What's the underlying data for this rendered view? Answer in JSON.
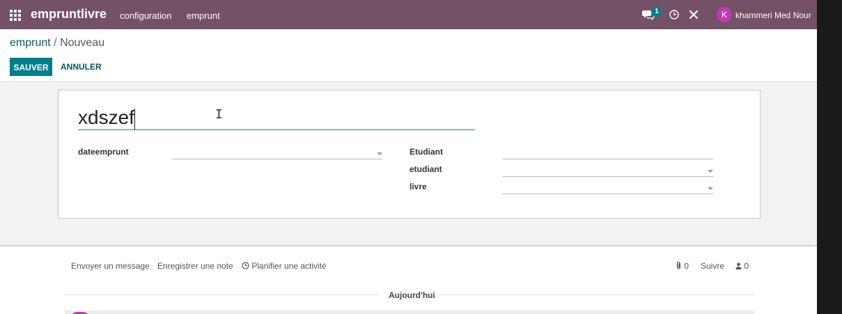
{
  "navbar": {
    "app_name": "empruntlivre",
    "menu_items": [
      "configuration",
      "emprunt"
    ],
    "messages_badge": "1",
    "user_initial": "K",
    "user_name": "khammeri Med Nour"
  },
  "breadcrumb": {
    "parent": "emprunt",
    "separator": "/",
    "current": "Nouveau"
  },
  "buttons": {
    "save": "SAUVER",
    "cancel": "ANNULER"
  },
  "form": {
    "name_value": "xdszef",
    "fields": {
      "dateemprunt": {
        "label": "dateemprunt",
        "value": ""
      },
      "Etudiant": {
        "label": "Etudiant",
        "value": ""
      },
      "etudiant": {
        "label": "etudiant",
        "value": ""
      },
      "livre": {
        "label": "livre",
        "value": ""
      }
    }
  },
  "chatter": {
    "send_message": "Envoyer un message",
    "log_note": "Enregistrer une note",
    "schedule_activity": "Planifier une activité",
    "attachments_count": "0",
    "follow": "Suivre",
    "followers_count": "0",
    "today": "Aujourd'hui"
  },
  "colors": {
    "navbar": "#735166",
    "primary": "#01808c",
    "avatar": "#c13bb0"
  },
  "icons": [
    "apps-grid-icon",
    "chat-icon",
    "clock-icon",
    "tools-icon",
    "clock-icon",
    "paperclip-icon",
    "user-icon"
  ]
}
